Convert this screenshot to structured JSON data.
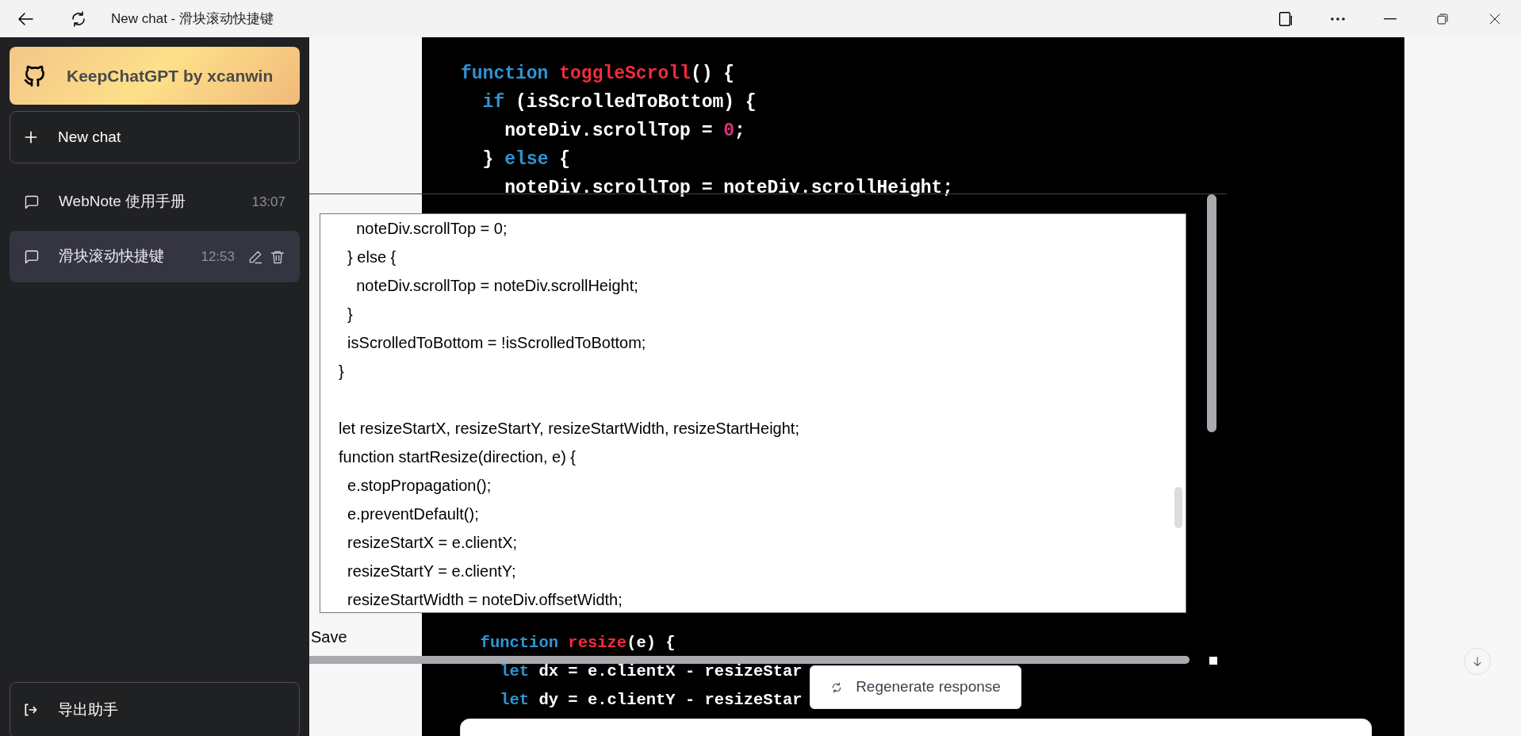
{
  "window": {
    "title": "New chat - 滑块滚动快捷键"
  },
  "sidebar": {
    "brand": "KeepChatGPT by xcanwin",
    "new_chat": "New chat",
    "chats": [
      {
        "title": "WebNote 使用手册",
        "time": "13:07",
        "selected": false
      },
      {
        "title": "滑块滚动快捷键",
        "time": "12:53",
        "selected": true
      }
    ],
    "footer": "导出助手"
  },
  "code_top": [
    [
      {
        "kind": "keyword",
        "text": "function "
      },
      {
        "kind": "function",
        "text": "toggleScroll"
      },
      {
        "kind": "plain",
        "text": "() {"
      }
    ],
    [
      {
        "kind": "keyword",
        "text": "  if"
      },
      {
        "kind": "plain",
        "text": " (isScrolledToBottom) {"
      }
    ],
    [
      {
        "kind": "plain",
        "text": "    noteDiv.scrollTop = "
      },
      {
        "kind": "number",
        "text": "0"
      },
      {
        "kind": "plain",
        "text": ";"
      }
    ],
    [
      {
        "kind": "plain",
        "text": "  } "
      },
      {
        "kind": "keyword",
        "text": "else"
      },
      {
        "kind": "plain",
        "text": " {"
      }
    ],
    [
      {
        "kind": "plain",
        "text": "    noteDiv.scrollTop = noteDiv.scrollHeight;"
      }
    ]
  ],
  "note": {
    "paragraphs": [
      [
        "    noteDiv.scrollTop = 0;",
        "  } else {",
        "    noteDiv.scrollTop = noteDiv.scrollHeight;",
        "  }",
        "  isScrolledToBottom = !isScrolledToBottom;",
        "}"
      ],
      [
        "let resizeStartX, resizeStartY, resizeStartWidth, resizeStartHeight;",
        "function startResize(direction, e) {",
        "  e.stopPropagation();",
        "  e.preventDefault();",
        "  resizeStartX = e.clientX;",
        "  resizeStartY = e.clientY;",
        "  resizeStartWidth = noteDiv.offsetWidth;"
      ]
    ],
    "save": "Save"
  },
  "code_bottom": [
    [
      {
        "kind": "keyword",
        "text": "  function "
      },
      {
        "kind": "function",
        "text": "resize"
      },
      {
        "kind": "plain",
        "text": "(e) {"
      }
    ],
    [
      {
        "kind": "keyword",
        "text": "    let"
      },
      {
        "kind": "plain",
        "text": " dx = e.clientX - resizeStar"
      }
    ],
    [
      {
        "kind": "keyword",
        "text": "    let"
      },
      {
        "kind": "plain",
        "text": " dy = e.clientY - resizeStar"
      }
    ]
  ],
  "regenerate": "Regenerate response"
}
